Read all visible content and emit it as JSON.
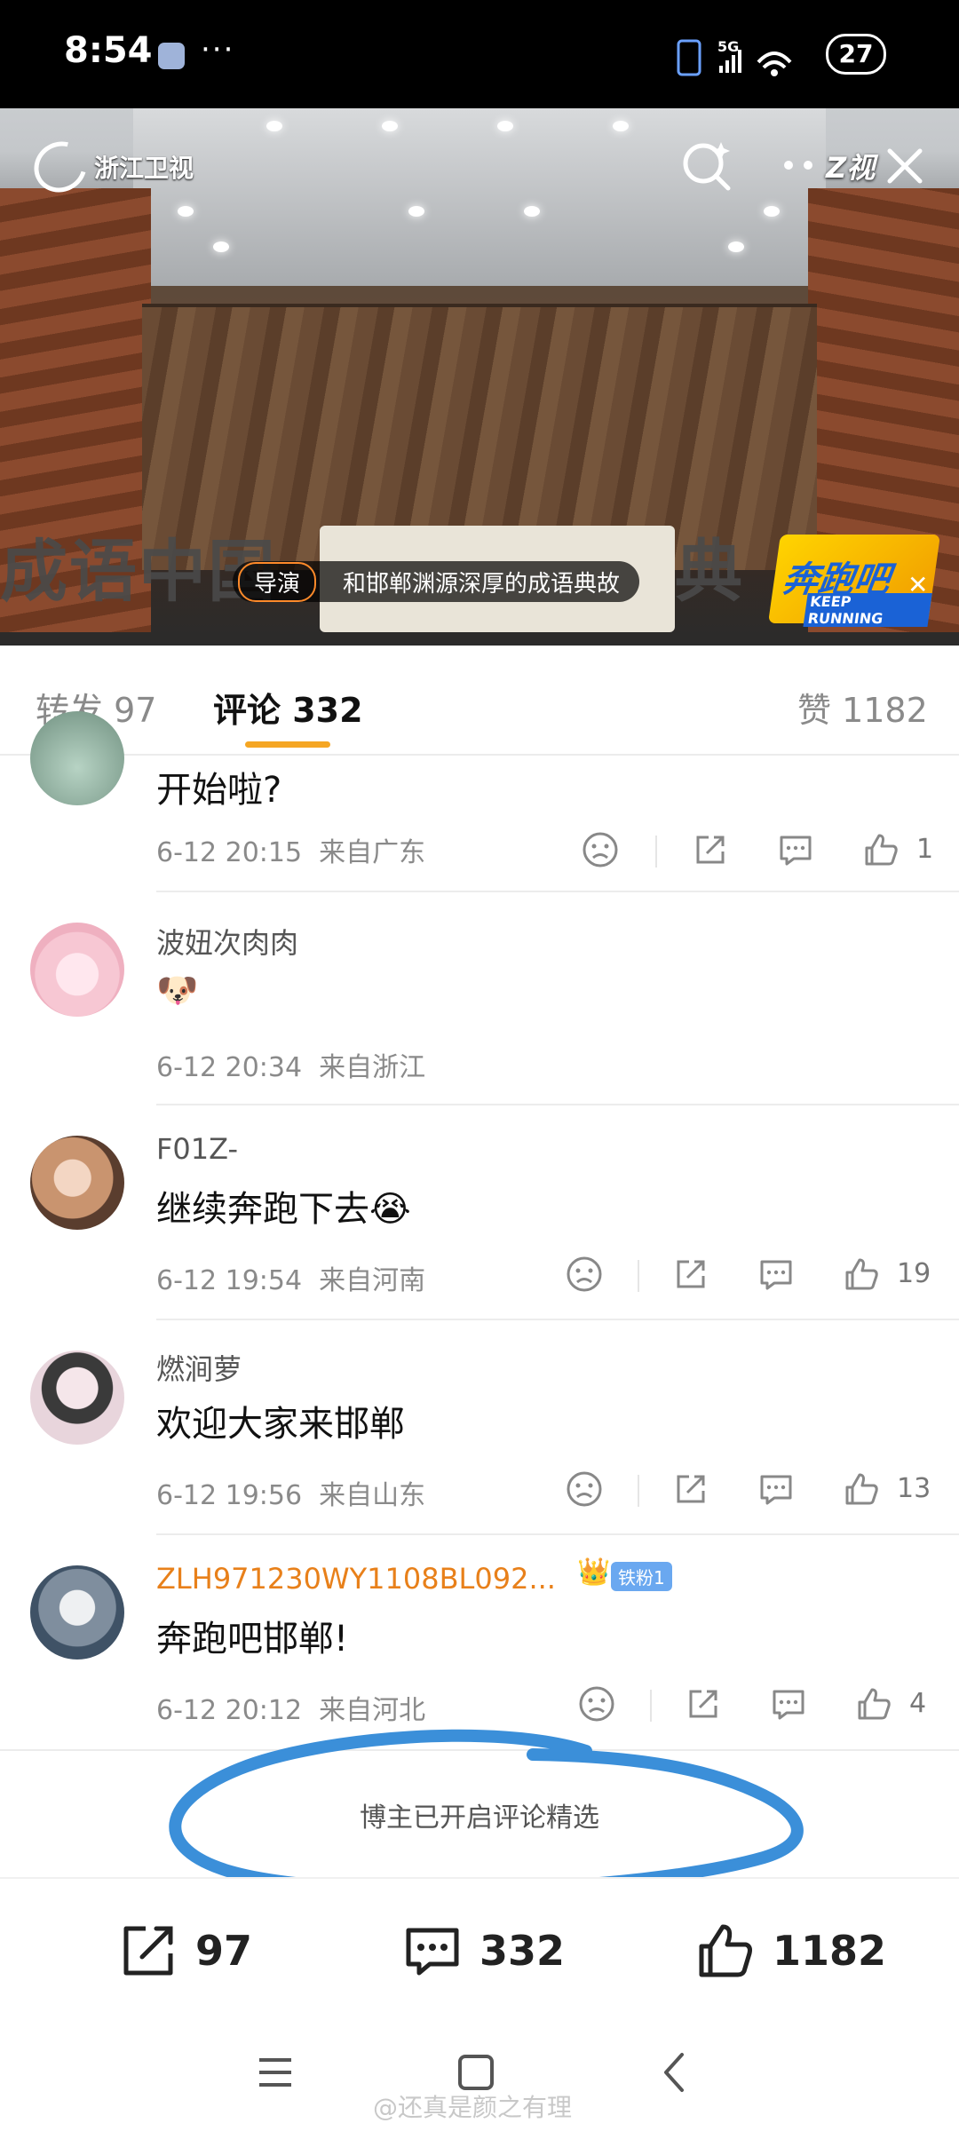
{
  "status_bar": {
    "time": "8:54",
    "more": "···",
    "network": "5G",
    "wifi_level": "6",
    "battery": "27"
  },
  "video": {
    "channel_logo": "浙江卫视",
    "slogan_left": "成语中国",
    "slogan_right": "典",
    "caption_tag": "导演",
    "caption_text": "和邯郸渊源深厚的成语典故",
    "show_logo_main": "奔跑吧",
    "show_logo_sub": "KEEP RUNNING",
    "top_right_brand": "Z视"
  },
  "tabs": [
    {
      "label": "转发 97"
    },
    {
      "label": "评论 332"
    },
    {
      "label": "赞 1182"
    }
  ],
  "comments": [
    {
      "username": "",
      "text": "开始啦?",
      "time": "6-12 20:15",
      "location": "来自广东",
      "likes": "1"
    },
    {
      "username": "波妞次肉肉",
      "text": "🐶",
      "time": "6-12 20:34",
      "location": "来自浙江",
      "likes": ""
    },
    {
      "username": "F01Z-",
      "text": "继续奔跑下去😭",
      "time": "6-12 19:54",
      "location": "来自河南",
      "likes": "19"
    },
    {
      "username": "燃涧萝",
      "text": "欢迎大家来邯郸",
      "time": "6-12 19:56",
      "location": "来自山东",
      "likes": "13"
    },
    {
      "username": "ZLH971230WY1108BL092...",
      "badge": "铁粉1",
      "text": "奔跑吧邯郸!",
      "time": "6-12 20:12",
      "location": "来自河北",
      "likes": "4"
    }
  ],
  "selected_note": "博主已开启评论精选",
  "bottom_bar": {
    "reposts": "97",
    "comments": "332",
    "likes": "1182"
  },
  "watermark": "@还真是颜之有理",
  "colors": {
    "accent": "#f5a623",
    "vip_name": "#e8801a",
    "annotation": "#3b8fd9"
  }
}
